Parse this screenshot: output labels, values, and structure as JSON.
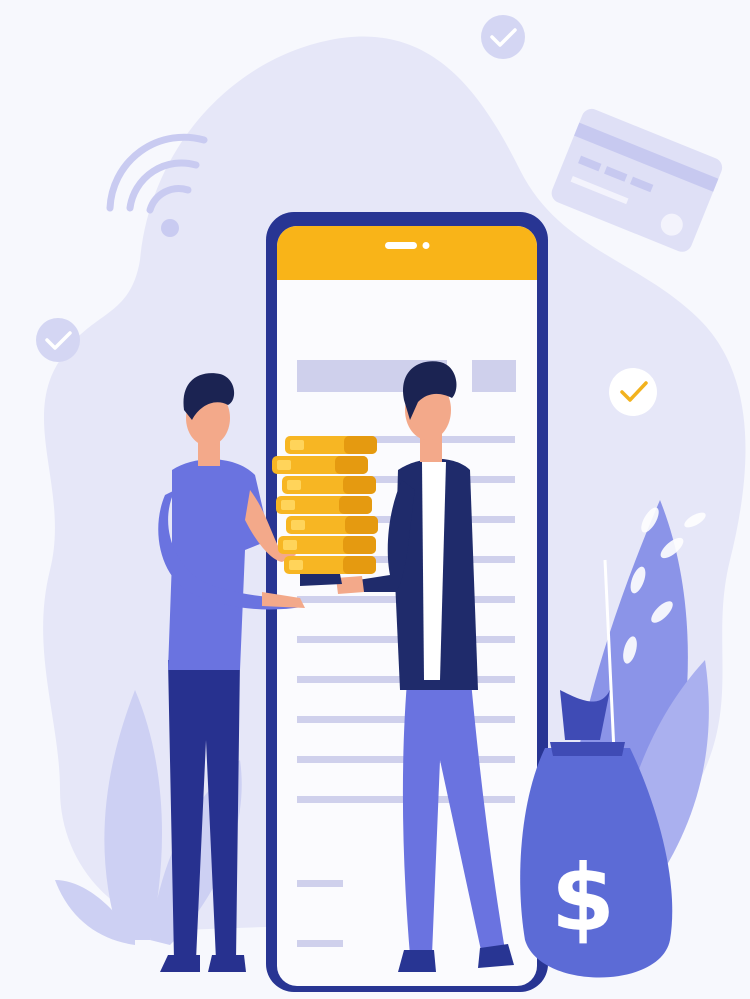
{
  "illustration": {
    "subject": "person-handing-coins-to-person-in-front-of-smartphone",
    "icons": [
      "wifi-icon",
      "check-icon",
      "credit-card-icon",
      "coin-stack-icon",
      "money-bag-icon",
      "smartphone-icon",
      "leaf-plant-icon"
    ],
    "money_bag_symbol": "$"
  },
  "colors": {
    "background": "#f7f8fd",
    "blob": "#e4e5f7",
    "blob_dark": "#d6d8f2",
    "phone_frame": "#283593",
    "phone_header": "#f9b418",
    "phone_screen": "#fbfbfe",
    "text_lines": "#cfd0ec",
    "coin": "#f7b623",
    "coin_shade": "#e59a10",
    "coin_highlight": "#ffd45a",
    "bag": "#5c6bd6",
    "bag_dark": "#3f4bb5",
    "shirt": "#6a73e0",
    "pants": "#27318f",
    "skin": "#f3a98a",
    "hair": "#1b2352",
    "jacket": "#1f2b6b",
    "leaf": "#c5c9f0",
    "check_yellow": "#f2b21e"
  }
}
